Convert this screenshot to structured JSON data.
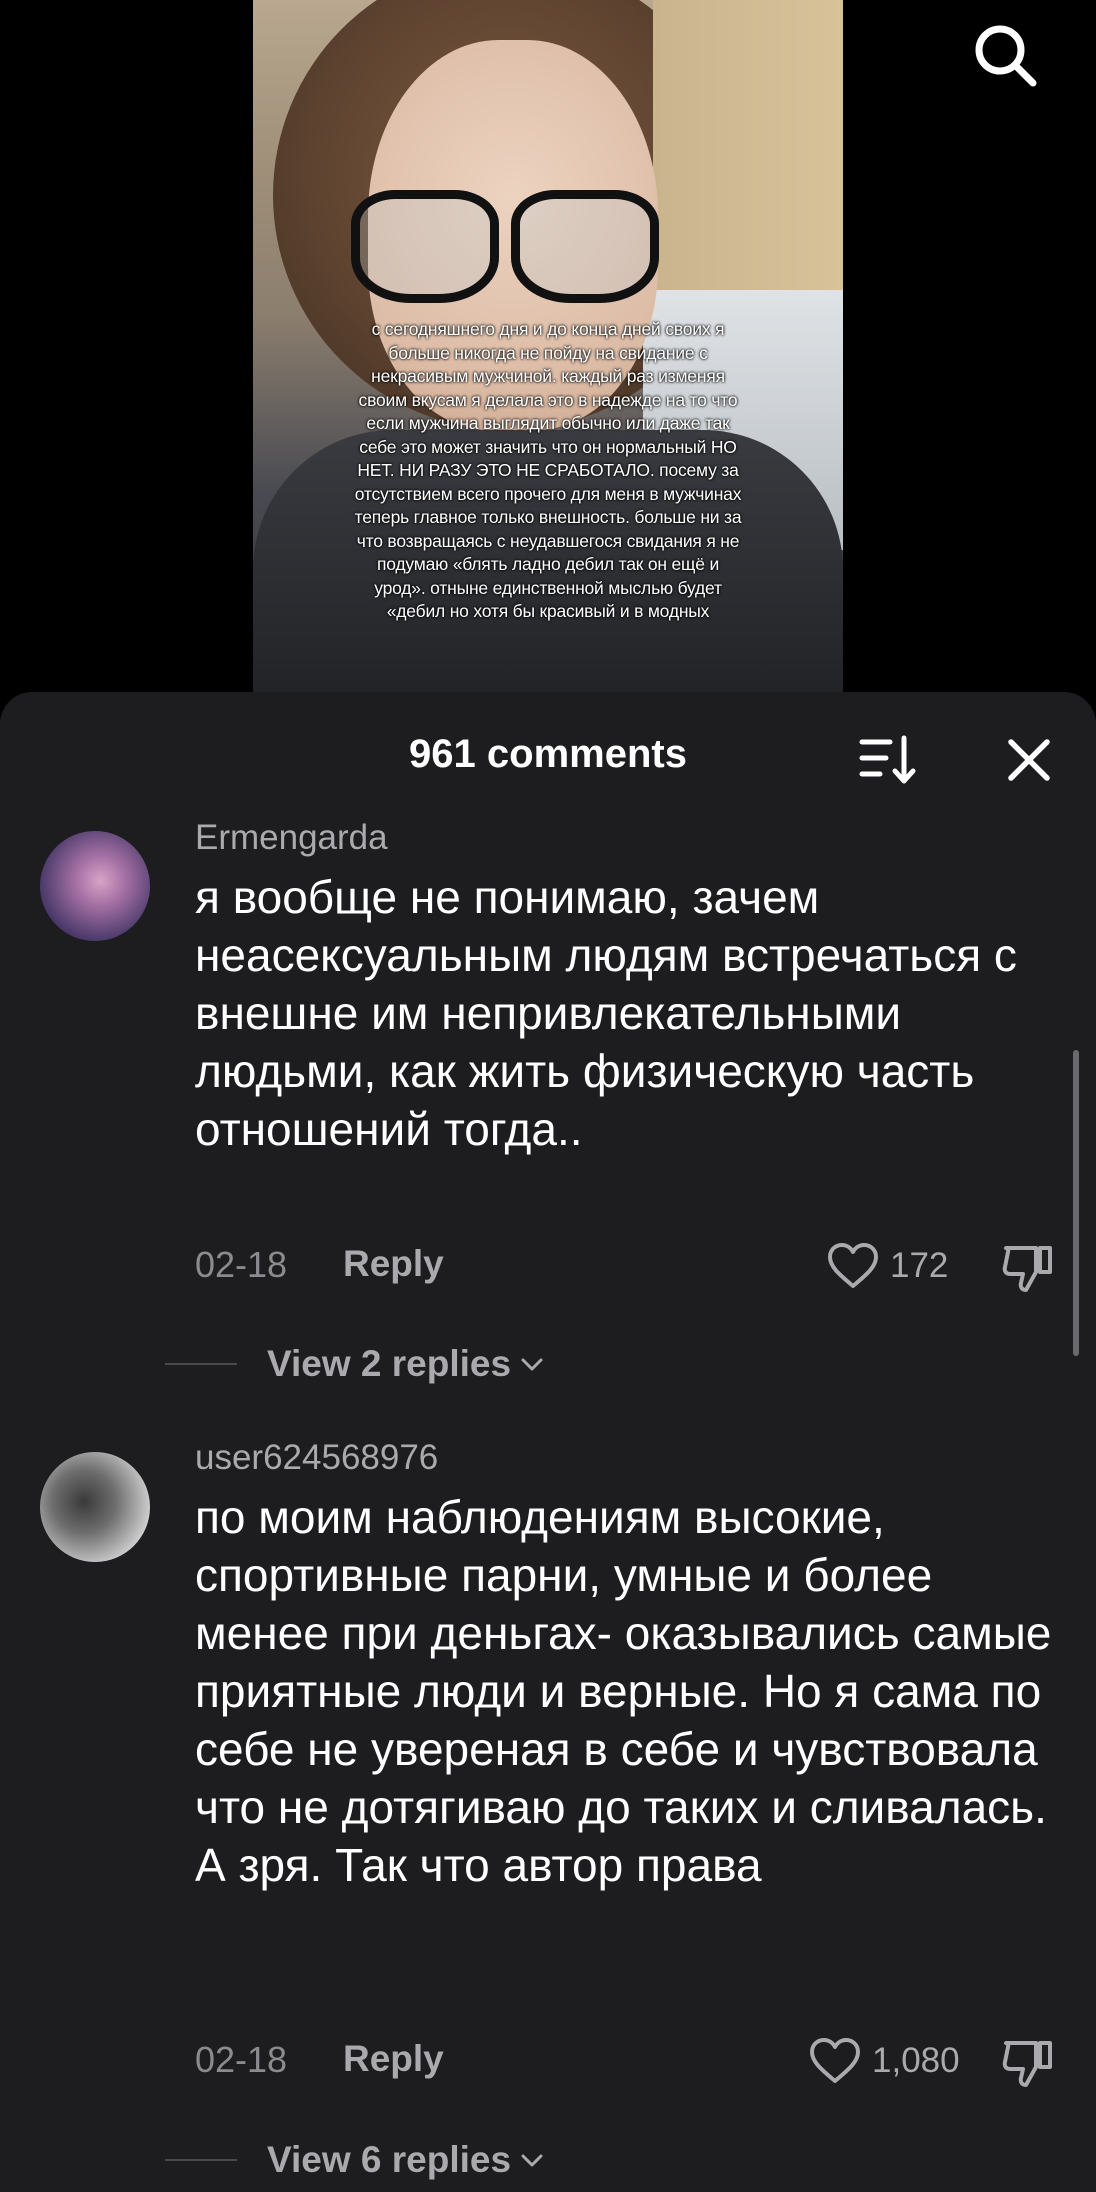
{
  "video": {
    "overlay_text": "с сегодняшнего дня и до конца дней своих я больше никогда не пойду на свидание с некрасивым мужчиной. каждый раз изменяя своим вкусам я делала это в надежде на то что если мужчина выглядит обычно или даже так себе это может значить что он нормальный НО НЕТ. НИ РАЗУ ЭТО НЕ СРАБОТАЛО. посему за отсутствием всего прочего для меня в мужчинах теперь главное только внешность. больше ни за что возвращаясь с неудавшегося свидания я не подумаю «блять ладно дебил так он ещё и урод». отныне единственной мыслью будет «дебил но хотя бы красивый и в модных"
  },
  "sheet": {
    "title": "961 comments"
  },
  "comments": [
    {
      "username": "Ermengarda",
      "text": "я вообще не понимаю, зачем неасексуальным людям встречаться с внешне им непривлекательными людьми, как жить физическую часть отношений тогда..",
      "date": "02-18",
      "reply_label": "Reply",
      "likes": "172",
      "view_replies": "View 2 replies"
    },
    {
      "username": "user624568976",
      "text": "по моим наблюдениям высокие, спортивные парни, умные и более менее при деньгах- оказывались самые приятные люди и верные. Но я сама по себе не увереная в себе и чувствовала что не дотягиваю до таких и сливалась. А зря. Так что автор права",
      "date": "02-18",
      "reply_label": "Reply",
      "likes": "1,080",
      "view_replies": "View 6 replies"
    }
  ],
  "colors": {
    "sheet_background": "#1d1d1f",
    "secondary_text": "#a9a9ae",
    "primary_text": "#ffffff"
  },
  "icons": {
    "search": "search-icon",
    "sort": "sort-icon",
    "close": "close-icon",
    "like": "heart-icon",
    "dislike": "thumbs-down-icon",
    "expand": "chevron-down-icon"
  }
}
